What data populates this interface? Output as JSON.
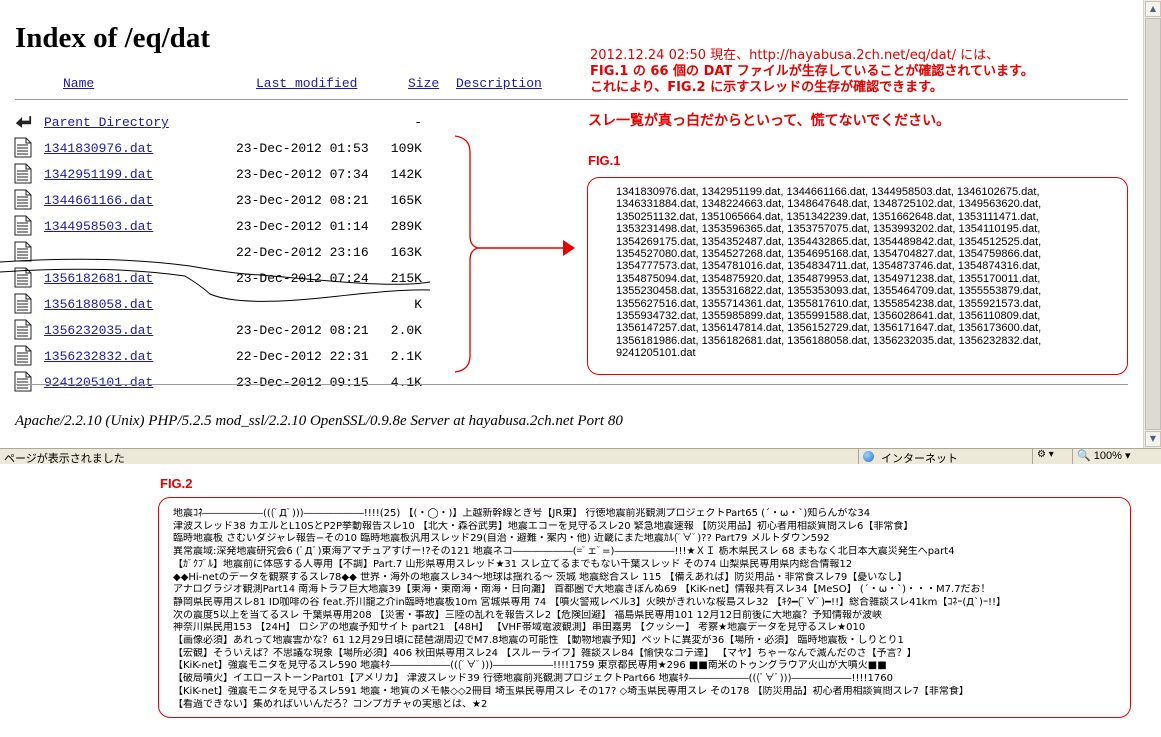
{
  "title": "Index of /eq/dat",
  "columns": {
    "name": "Name",
    "last_modified": "Last modified",
    "size": "Size",
    "description": "Description"
  },
  "parent": {
    "label": "Parent Directory",
    "size": "-"
  },
  "files": [
    {
      "name": "1341830976.dat",
      "date": "23-Dec-2012 01:53",
      "size": "109K"
    },
    {
      "name": "1342951199.dat",
      "date": "23-Dec-2012 07:34",
      "size": "142K"
    },
    {
      "name": "1344661166.dat",
      "date": "23-Dec-2012 08:21",
      "size": "165K"
    },
    {
      "name": "1344958503.dat",
      "date": "23-Dec-2012 01:14",
      "size": "289K"
    },
    {
      "name": "",
      "date": "22-Dec-2012 23:16",
      "size": "163K"
    },
    {
      "name": "1356182681.dat",
      "date": "23-Dec-2012 07:24",
      "size": "215K"
    },
    {
      "name": "1356188058.dat",
      "date": "",
      "size": "K"
    },
    {
      "name": "1356232035.dat",
      "date": "23-Dec-2012 08:21",
      "size": "2.0K"
    },
    {
      "name": "1356232832.dat",
      "date": "22-Dec-2012 22:31",
      "size": "2.1K"
    },
    {
      "name": "9241205101.dat",
      "date": "23-Dec-2012 09:15",
      "size": "4.1K"
    }
  ],
  "footer": "Apache/2.2.10 (Unix) PHP/5.2.5 mod_ssl/2.2.10 OpenSSL/0.9.8e Server at hayabusa.2ch.net Port 80",
  "note": {
    "lines": [
      "2012.12.24 02:50 現在、http://hayabusa.2ch.net/eq/dat/ には、",
      "FIG.1 の 66 個の DAT ファイルが生存していることが確認されています。",
      "これにより、FIG.2 に示すスレッドの生存が確認できます。"
    ],
    "warning": "スレ一覧が真っ白だからといって、慌てないでください。"
  },
  "fig1": {
    "label": "FIG.1",
    "lines": [
      "1341830976.dat, 1342951199.dat, 1344661166.dat, 1344958503.dat, 1346102675.dat,",
      "1346331884.dat, 1348224663.dat, 1348647648.dat, 1348725102.dat, 1349563620.dat,",
      "1350251132.dat, 1351065664.dat, 1351342239.dat, 1351662648.dat, 1353111471.dat,",
      "1353231498.dat, 1353596365.dat, 1353757075.dat, 1353993202.dat, 1354110195.dat,",
      "1354269175.dat, 1354352487.dat, 1354432865.dat, 1354489842.dat, 1354512525.dat,",
      "1354527080.dat, 1354527268.dat, 1354695168.dat, 1354704827.dat, 1354759866.dat,",
      "1354777573.dat, 1354781016.dat, 1354834711.dat, 1354873746.dat, 1354874316.dat,",
      "1354875094.dat, 1354875920.dat, 1354879953.dat, 1354971238.dat, 1355170011.dat,",
      "1355230458.dat, 1355316822.dat, 1355353093.dat, 1355464709.dat, 1355553879.dat,",
      "1355627516.dat, 1355714361.dat, 1355817610.dat, 1355854238.dat, 1355921573.dat,",
      "1355934732.dat, 1355985899.dat, 1355991588.dat, 1356028641.dat, 1356110809.dat,",
      "1356147257.dat, 1356147814.dat, 1356152729.dat, 1356171647.dat, 1356173600.dat,",
      "1356181986.dat, 1356182681.dat, 1356188058.dat, 1356232035.dat, 1356232832.dat,",
      "9241205101.dat"
    ]
  },
  "fig2": {
    "label": "FIG.2",
    "lines": [
      "地震ｺﾈ――――――(((ﾟДﾟ)))――――――!!!!(25) 【(・◯・)】上越新幹線とき号【JR東】 行徳地震前兆観測プロジェクトPart65 (´・ω・`)知らんがな34",
      "津波スレッド38 カエルとL10SとP2P挙動報告スレ10 【北大・森谷武男】地震エコーを見守るスレ20 緊急地震速報 【防災用品】初心者用相談質問スレ6【非常食】",
      "臨時地震板 さむいダジャレ報告−その10 臨時地震板汎用スレッド29(自治・避難・案内・他) 近畿にまた地震ｶﾙ(ﾟ∀ﾟ)?? Part79 メルトダウン592",
      "異常震域:深発地震研究会6 (ﾟДﾟ)東海アマチュアすげー!?その121 地震ネコ――――――(=ﾟェﾟ=)――――――!!!★ＸＩ 栃木県民スレ 68 まもなく北日本大震災発生へpart4",
      "【ｶﾞｸﾌﾞﾙ】地震前に体感する人専用【不調】Part.7 山形県専用スレッド★31 スレ立てるまでもない千葉スレッド その74 山梨県民専用県内総合情報12",
      "◆◆Hi-netのデータを観察するスレ78◆◆ 世界・海外の地震スレ34〜地球は揺れる〜 茨城 地震総合スレ 115 【備えあれば】防災用品・非常食スレ79【憂いなし】",
      "アナログラジオ観測Part14 南海トラフ巨大地震39【東海・東南海・南海・日向灘】 首都圏で大地震きぼんぬ69 【KiK-net】情報共有スレ34【MeSO】 (´・ω・`)・・・M7.7だお！",
      "静岡県民専用スレ81 ID咖啡の谷 feat.芥川龍之介in臨時地震板10m 宮城県専用 74 【噴火警戒レベル3】火映がきれいな桜島スレ32 【ｷﾀ━(ﾟ∀ﾟ)━!!】総合雑談スレ41km【ｺﾈｰ(Д`)ｰ!!】",
      "次の震度5以上を当てるスレ 千葉県専用208 【災害・事故】三陸の乱れを報告スレ2【危険回避】 福島県民専用101 12月12日前後に大地震？予知情報が波峽",
      "神奈川県民用153 【24H】 ロシアの地震予知サイト part21 【48H】 【VHF帯域電波観測】串田嘉男 【クッシー】 考察★地震データを見守るスレ★010",
      "【画像必須】あれって地震雲かな？61 12月29日頃に琵琶湖周辺でM7.8地震の可能性 【動物地震予知】ペットに異変が36【場所・必須】 臨時地震板・しりとり1",
      "【宏観】そういえば？不思議な現象【場所必須】406 秋田県専用スレ24 【スルーライフ】雑談スレ84【愉快なコテ達】 【マヤ】ちゃーなんで滅んだのさ【予言？】",
      "【KiK-net】強震モニタを見守るスレ590 地震ｷﾀ――――――(((ﾟ∀ﾟ)))――――――!!!!1759 東京都民専用★296 ■■南米のトゥングラウア火山が大噴火■■",
      "【破局噴火】イエローストーンPart01【アメリカ】 津波スレッド39 行徳地震前兆観測プロジェクトPart66 地震ｷﾀ――――――(((ﾟ∀ﾟ)))――――――!!!!1760",
      "【KiK-net】強震モニタを見守るスレ591 地震・地質のメモ帳◇◇2冊目 埼玉県民専用スレ その17? ◇埼玉県民専用スレ その178 【防災用品】初心者用相談質問スレ7【非常食】",
      "【看過できない】集めればいいんだろ？コンプガチャの実態とは、★2"
    ]
  },
  "statusbar": {
    "text": "ページが表示されました",
    "zone": "インターネット",
    "zoom": "100%"
  },
  "colors": {
    "accent": "#e60000",
    "link": "#1a1aa6"
  }
}
